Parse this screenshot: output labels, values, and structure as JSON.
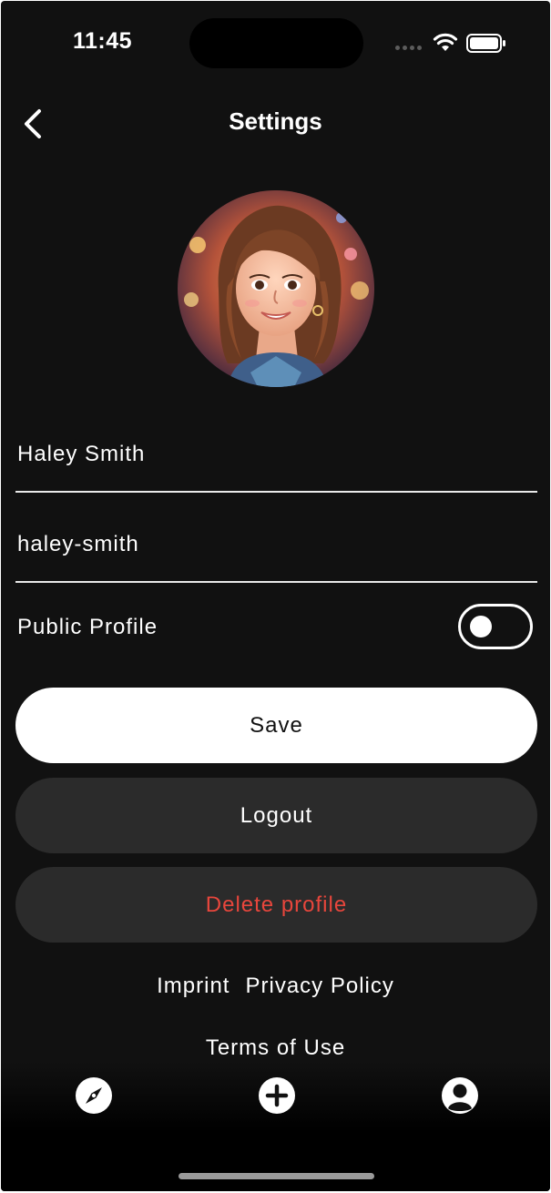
{
  "status_bar": {
    "time": "11:45"
  },
  "header": {
    "title": "Settings",
    "back_icon": "chevron-left-icon"
  },
  "profile": {
    "avatar": "profile-avatar",
    "name": "Haley Smith",
    "username": "haley-smith",
    "public_profile_label": "Public Profile",
    "public_profile_enabled": false
  },
  "actions": {
    "save_label": "Save",
    "logout_label": "Logout",
    "delete_label": "Delete profile"
  },
  "links": {
    "imprint": "Imprint",
    "privacy_policy": "Privacy Policy",
    "terms_of_use": "Terms of Use"
  },
  "tab_bar": {
    "items": [
      {
        "icon": "compass-icon"
      },
      {
        "icon": "plus-circle-icon"
      },
      {
        "icon": "user-circle-icon"
      }
    ]
  },
  "colors": {
    "background": "#111111",
    "button_dark": "#2b2b2b",
    "danger": "#e8463c",
    "primary_button": "#ffffff"
  }
}
